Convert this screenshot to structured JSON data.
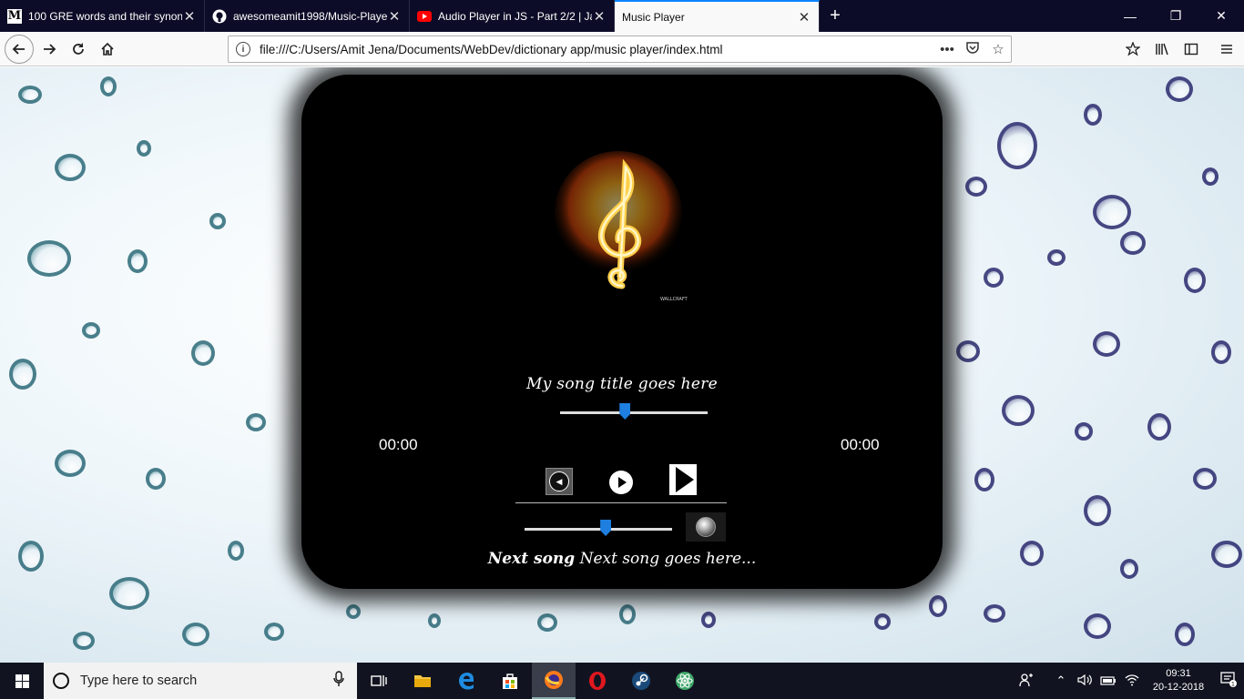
{
  "tabs": [
    {
      "title": "100 GRE words and their synonyms",
      "favicon": "M",
      "icon": "medium-icon",
      "active": false
    },
    {
      "title": "awesomeamit1998/Music-Player",
      "favicon": "",
      "icon": "github-icon",
      "active": false
    },
    {
      "title": "Audio Player in JS - Part 2/2 | JavaScript",
      "favicon": "",
      "icon": "youtube-icon",
      "active": false
    },
    {
      "title": "Music Player",
      "favicon": "",
      "icon": "",
      "active": true
    }
  ],
  "browser": {
    "url": "file:///C:/Users/Amit Jena/Documents/WebDev/dictionary app/music player/index.html",
    "accent_color": "#0a84ff"
  },
  "player": {
    "song_title": "My song title goes here",
    "current_time": "00:00",
    "duration": "00:00",
    "seek_progress": 0.44,
    "volume_level": 0.55,
    "next_song_label": "Next song",
    "next_song_title": "Next song goes here...",
    "artwork_watermark": "WALLCRAFT",
    "thumb_color": "#1e7fe0"
  },
  "taskbar": {
    "search_placeholder": "Type here to search",
    "time": "09:31",
    "date": "20-12-2018",
    "notification_count": "1",
    "apps": [
      "task-view-icon",
      "file-explorer-icon",
      "edge-icon",
      "store-icon",
      "firefox-icon",
      "opera-icon",
      "steam-icon",
      "atom-icon"
    ]
  }
}
